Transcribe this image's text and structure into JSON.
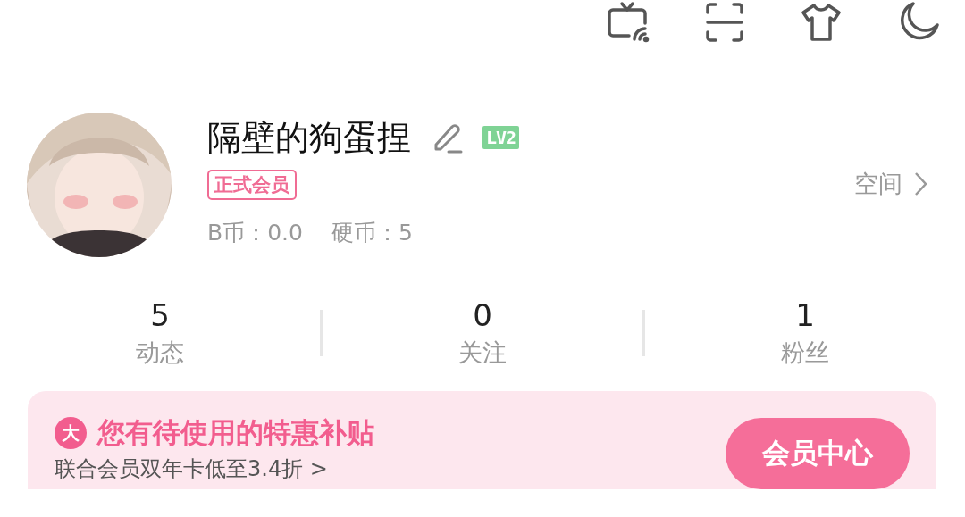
{
  "profile": {
    "name": "隔壁的狗蛋捏",
    "level": "LV2",
    "vip_tag": "正式会员",
    "coins": [
      {
        "label": "B币：",
        "value": "0.0"
      },
      {
        "label": "硬币：",
        "value": "5"
      }
    ],
    "space_link": "空间"
  },
  "stats": [
    {
      "value": "5",
      "label": "动态"
    },
    {
      "value": "0",
      "label": "关注"
    },
    {
      "value": "1",
      "label": "粉丝"
    }
  ],
  "vip_banner": {
    "badge": "大",
    "title": "您有待使用的特惠补贴",
    "subtitle": "联合会员双年卡低至3.4折 >",
    "button": "会员中心"
  }
}
